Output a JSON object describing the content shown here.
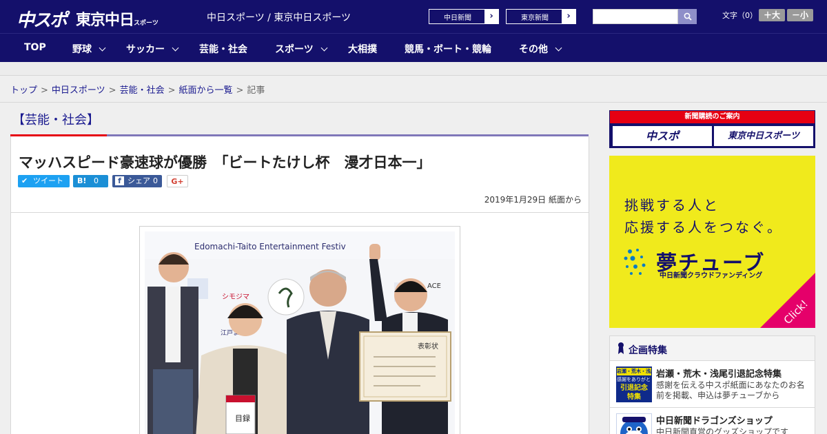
{
  "header": {
    "logo_chuspo": "中スポ",
    "logo_tokyo": "東京中日",
    "logo_tokyo_sub": "スポーツ",
    "site_title": "中日スポーツ / 東京中日スポーツ",
    "links": [
      {
        "label": "中日新聞"
      },
      {
        "label": "東京新聞"
      }
    ],
    "search": {
      "placeholder": "",
      "value": ""
    },
    "font_size_label": "文字（0）",
    "font_larger": "＋大",
    "font_smaller": "－小"
  },
  "nav": {
    "items": [
      {
        "label": "TOP",
        "has_dropdown": false
      },
      {
        "label": "野球",
        "has_dropdown": true
      },
      {
        "label": "サッカー",
        "has_dropdown": true
      },
      {
        "label": "芸能・社会",
        "has_dropdown": false
      },
      {
        "label": "スポーツ",
        "has_dropdown": true
      },
      {
        "label": "大相撲",
        "has_dropdown": false
      },
      {
        "label": "競馬・ボート・競輪",
        "has_dropdown": false
      },
      {
        "label": "その他",
        "has_dropdown": true
      }
    ]
  },
  "breadcrumb": {
    "items": [
      "トップ",
      "中日スポーツ",
      "芸能・社会",
      "紙面から一覧"
    ],
    "current": "記事",
    "separator": ">"
  },
  "article": {
    "category": "【芸能・社会】",
    "headline": "マッハスピード豪速球が優勝　「ビートたけし杯　漫才日本一」",
    "share": {
      "tweet": "ツイート",
      "hatena_icon": "B!",
      "hatena_count": "0",
      "facebook_label": "シェア",
      "facebook_count": "0",
      "gplus": "G+"
    },
    "date": "2019年1月29日",
    "source": "紙面から",
    "photo": {
      "banner_text": "Edomachi-Taito Entertainment Festiv",
      "sponsor_1": "シモジマ",
      "sponsor_2": "ACE",
      "sign_left": "江戸まち",
      "certificate_title": "表彰状",
      "envelope_text": "目録"
    }
  },
  "sidebar": {
    "subscribe": {
      "title": "新聞購読のご案内",
      "button_1": "中スポ",
      "button_2": "東京中日スポーツ"
    },
    "ad": {
      "line1": "挑戦する人と",
      "line2": "応援する人をつなぐ。",
      "brand": "夢チューブ",
      "sub": "中日新聞クラウドファンディング",
      "click": "Click!"
    },
    "features": {
      "title": "企画特集",
      "items": [
        {
          "thumb_text": [
            "岩瀬・荒木・浅尾",
            "感謝をありがとう",
            "引退記念",
            "特集"
          ],
          "title": "岩瀬・荒木・浅尾引退記念特集",
          "desc": "感謝を伝える中スポ紙面にあなたのお名前を掲載、申込は夢チューブから"
        },
        {
          "thumb_text": [],
          "title": "中日新聞ドラゴンズショップ",
          "desc": "中日新聞直営のグッズショップです"
        }
      ]
    }
  },
  "colors": {
    "brand_navy": "#14106b",
    "accent_red": "#e60012",
    "ad_yellow": "#f0ea1c",
    "ad_pink": "#e5006a"
  }
}
